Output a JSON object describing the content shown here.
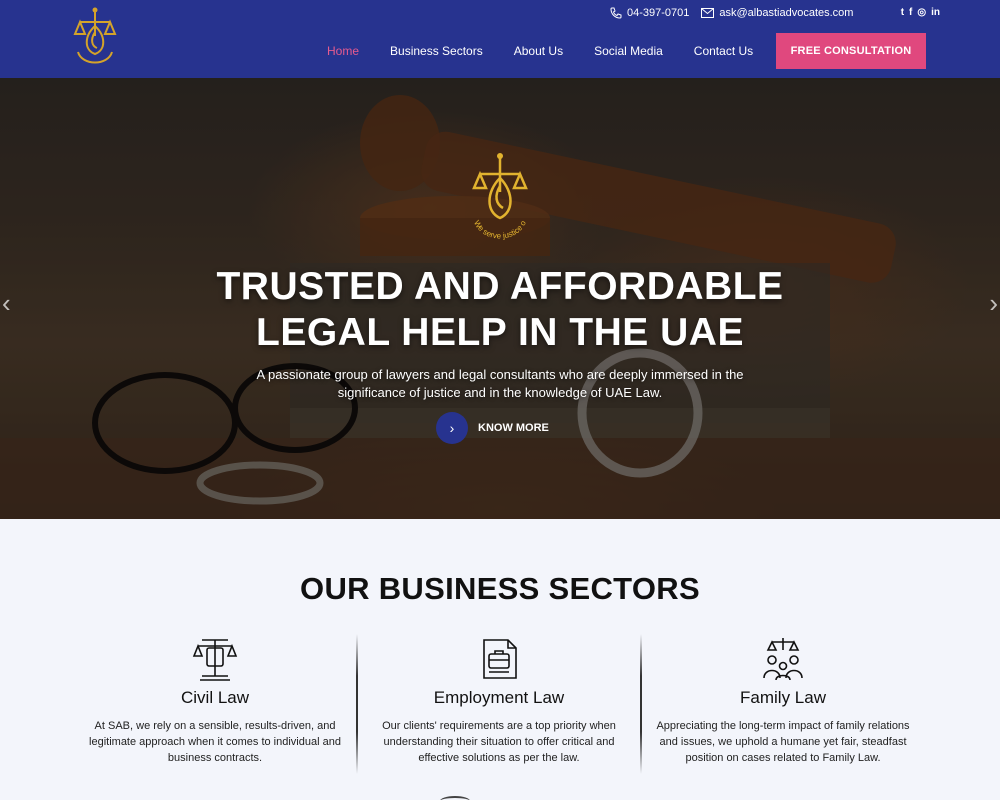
{
  "header": {
    "phone": "04-397-0701",
    "email": "ask@albastiadvocates.com",
    "social": [
      "twitter",
      "facebook",
      "instagram",
      "linkedin"
    ],
    "social_glyphs": [
      "t",
      "f",
      "◎",
      "in"
    ],
    "nav": [
      {
        "label": "Home",
        "active": true
      },
      {
        "label": "Business Sectors",
        "active": false
      },
      {
        "label": "About Us",
        "active": false
      },
      {
        "label": "Social Media",
        "active": false
      },
      {
        "label": "Contact Us",
        "active": false
      }
    ],
    "cta_label": "FREE CONSULTATION",
    "colors": {
      "bar": "#27338f",
      "accent": "#e0487e",
      "active_link": "#e65b8f",
      "gold": "#d4a32a"
    }
  },
  "hero": {
    "title_line1": "TRUSTED AND AFFORDABLE",
    "title_line2": "LEGAL HELP IN THE UAE",
    "subtitle": "A passionate group of lawyers and legal consultants who are deeply immersed in the significance of justice and in the knowledge of UAE Law.",
    "button_label": "KNOW MORE",
    "logo_tagline": "We serve justice on time"
  },
  "sectors": {
    "title": "OUR BUSINESS SECTORS",
    "items": [
      {
        "icon": "civil-law-icon",
        "title": "Civil Law",
        "text": "At SAB, we rely on a sensible, results-driven, and legitimate approach when it comes to individual and business contracts."
      },
      {
        "icon": "employment-law-icon",
        "title": "Employment Law",
        "text": "Our clients' requirements are a top priority when understanding their situation to offer critical and effective solutions as per the law."
      },
      {
        "icon": "family-law-icon",
        "title": "Family Law",
        "text": "Appreciating the long-term impact of family relations and issues, we uphold a humane yet fair, steadfast position on cases related to Family Law."
      }
    ]
  }
}
